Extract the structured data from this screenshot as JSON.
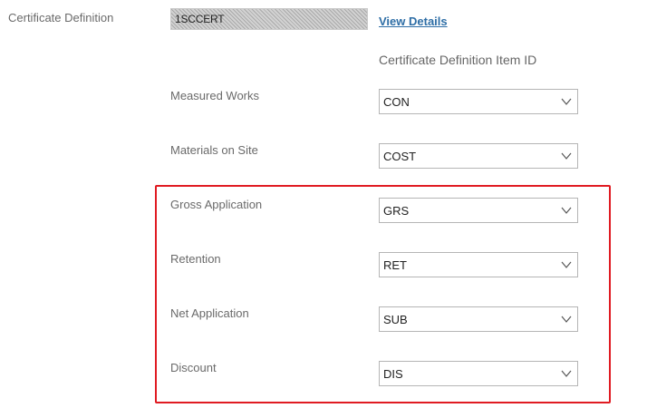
{
  "form": {
    "certificate_definition_label": "Certificate Definition",
    "certificate_definition_value": "1SCCERT",
    "view_details_link": "View Details",
    "item_id_header": "Certificate Definition Item ID"
  },
  "rows": [
    {
      "label": "Measured Works",
      "value": "CON"
    },
    {
      "label": "Materials on Site",
      "value": "COST"
    },
    {
      "label": "Gross Application",
      "value": "GRS"
    },
    {
      "label": "Retention",
      "value": "RET"
    },
    {
      "label": "Net Application",
      "value": "SUB"
    },
    {
      "label": "Discount",
      "value": "DIS"
    }
  ],
  "icons": {
    "dropdown": "chevron-down-icon"
  },
  "colors": {
    "highlight": "#e01b22",
    "link": "#2e6ea6"
  }
}
